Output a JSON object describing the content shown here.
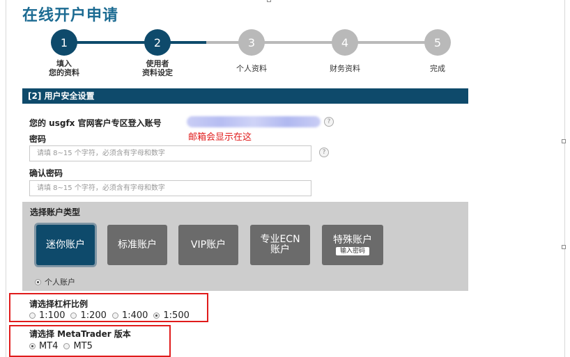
{
  "page": {
    "title": "在线开户申请"
  },
  "steps": [
    {
      "number": "1",
      "label_line1": "填入",
      "label_line2": "您的资料",
      "state": "done"
    },
    {
      "number": "2",
      "label_line1": "使用者",
      "label_line2": "资料设定",
      "state": "done"
    },
    {
      "number": "3",
      "label_line1": "个人资料",
      "label_line2": "",
      "state": "todo"
    },
    {
      "number": "4",
      "label_line1": "财务资料",
      "label_line2": "",
      "state": "todo"
    },
    {
      "number": "5",
      "label_line1": "完成",
      "label_line2": "",
      "state": "todo"
    }
  ],
  "section": {
    "title": "[2] 用户安全设置"
  },
  "form": {
    "login_label": "您的 usgfx 官网客户专区登入账号",
    "email_note": "邮箱会显示在这",
    "help_glyph": "?",
    "password_label": "密码",
    "password_placeholder": "请填 8~15 个字符，必须含有字母和数字",
    "confirm_label": "确认密码",
    "confirm_placeholder": "请填 8~15 个字符，必须含有字母和数字"
  },
  "account_type": {
    "title": "选择账户类型",
    "buttons": [
      {
        "label": "迷你账户",
        "selected": true
      },
      {
        "label": "标准账户",
        "selected": false
      },
      {
        "label": "VIP账户",
        "selected": false
      },
      {
        "label_line1": "专业ECN",
        "label_line2": "账户",
        "selected": false
      },
      {
        "label": "特殊账户",
        "chip": "输入密码",
        "selected": false
      }
    ],
    "personal_label": "个人账户"
  },
  "leverage": {
    "title": "请选择杠杆比例",
    "options": [
      "1:100",
      "1:200",
      "1:400",
      "1:500"
    ],
    "selected": "1:500"
  },
  "metatrader": {
    "title": "请选择 MetaTrader 版本",
    "options": [
      "MT4",
      "MT5"
    ],
    "selected": "MT4"
  },
  "colors": {
    "primary": "#0e4a6b",
    "title": "#1c6b92",
    "todo": "#b9b9b9",
    "highlight": "#e01b1b"
  }
}
